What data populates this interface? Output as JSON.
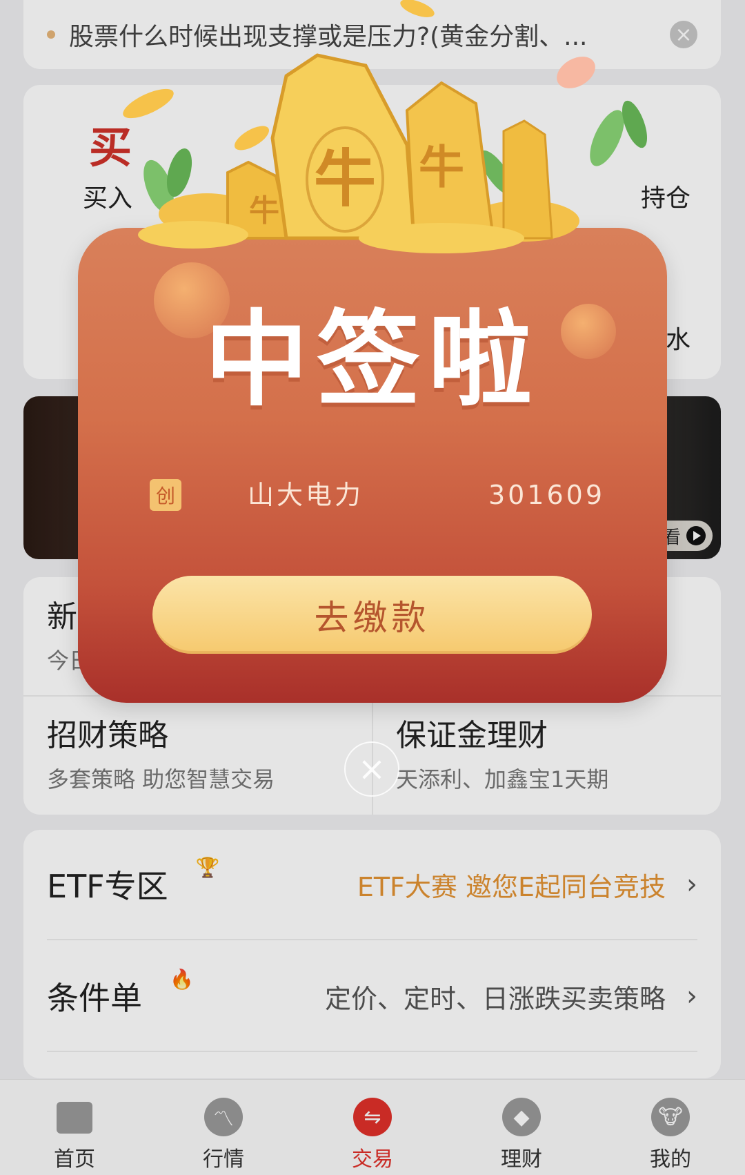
{
  "news": {
    "text": "股票什么时候出现支撑或是压力?(黄金分割、...",
    "close_icon": "close-icon"
  },
  "trade": {
    "buy_big": "买",
    "buy_label": "买入",
    "hold_label_partial": "持仓",
    "flow_label_partial": "水"
  },
  "banner": {
    "tag": "观看"
  },
  "grid": {
    "new_title_partial": "新",
    "new_sub_partial": "今日",
    "strategy_title": "招财策略",
    "strategy_sub": "多套策略 助您智慧交易",
    "margin_title": "保证金理财",
    "margin_sub": "天添利、加鑫宝1天期"
  },
  "list": {
    "etf_title": "ETF专区",
    "etf_desc": "ETF大赛 邀您E起同台竞技",
    "cond_title": "条件单",
    "cond_desc": "定价、定时、日涨跌买卖策略"
  },
  "tabs": [
    {
      "label": "首页",
      "icon": "home-icon"
    },
    {
      "label": "行情",
      "icon": "market-icon"
    },
    {
      "label": "交易",
      "icon": "trade-icon",
      "active": true
    },
    {
      "label": "理财",
      "icon": "finance-icon"
    },
    {
      "label": "我的",
      "icon": "profile-icon"
    }
  ],
  "popup": {
    "headline": "中签啦",
    "badge": "创",
    "stock_name": "山大电力",
    "stock_code": "301609",
    "pay_label": "去缴款",
    "coin_glyph": "牛"
  },
  "colors": {
    "accent_red": "#e0302a",
    "envelope_top": "#d9805a",
    "envelope_bottom": "#a9302a",
    "button_gold": "#f6c96e",
    "orange_text": "#e39233"
  }
}
